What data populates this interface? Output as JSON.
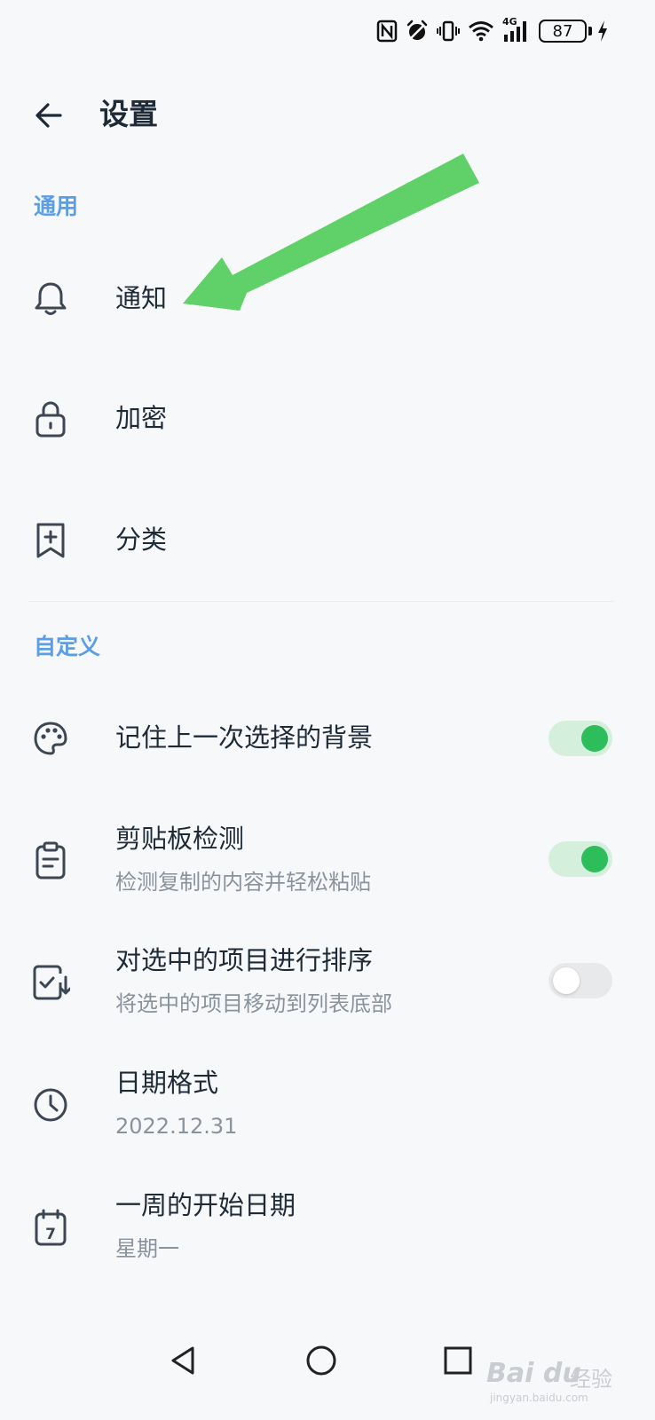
{
  "status_bar": {
    "battery_level": "87",
    "network_label": "4G",
    "icons": [
      "nfc-icon",
      "alarm-icon",
      "vibrate-icon",
      "wifi-icon",
      "signal-icon",
      "battery-icon",
      "charging-icon"
    ]
  },
  "header": {
    "back_icon": "arrow-left-icon",
    "title": "设置"
  },
  "sections": {
    "general": {
      "label": "通用",
      "items": [
        {
          "icon": "bell-icon",
          "title": "通知"
        },
        {
          "icon": "lock-icon",
          "title": "加密"
        },
        {
          "icon": "bookmark-plus-icon",
          "title": "分类"
        }
      ]
    },
    "custom": {
      "label": "自定义",
      "items": [
        {
          "icon": "palette-icon",
          "title": "记住上一次选择的背景",
          "toggle": true
        },
        {
          "icon": "clipboard-icon",
          "title": "剪贴板检测",
          "subtitle": "检测复制的内容并轻松粘贴",
          "toggle": true
        },
        {
          "icon": "checklist-sort-icon",
          "title": "对选中的项目进行排序",
          "subtitle": "将选中的项目移动到列表底部",
          "toggle": false
        },
        {
          "icon": "clock-icon",
          "title": "日期格式",
          "subtitle": "2022.12.31"
        },
        {
          "icon": "calendar-icon",
          "title": "一周的开始日期",
          "subtitle": "星期一"
        }
      ]
    }
  },
  "calendar_icon_text": "7",
  "nav_bar": {
    "icons": [
      "nav-back-icon",
      "nav-home-icon",
      "nav-recents-icon"
    ]
  },
  "watermark": {
    "logo": "Bai du",
    "cn": "经验",
    "url": "jingyan.baidu.com"
  },
  "colors": {
    "accent": "#5b9ee6",
    "toggle_on": "#2dbd5a",
    "toggle_on_track": "#d4efdc",
    "annotation_arrow": "#5fd168"
  }
}
